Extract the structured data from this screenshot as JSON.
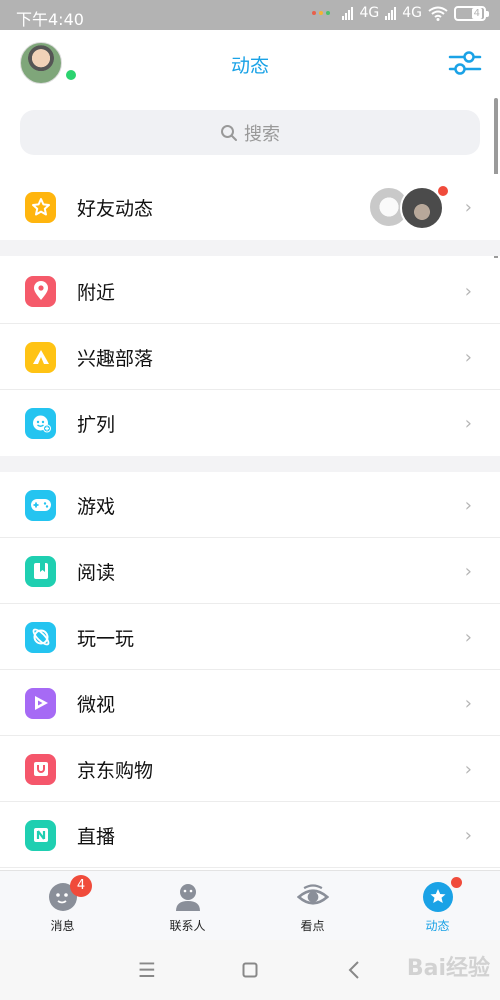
{
  "status_bar": {
    "time": "下午4:40",
    "network_1": "4G",
    "network_2": "4G",
    "battery": "4",
    "dot_colors": [
      "#e8604c",
      "#f5b335",
      "#4cc06a"
    ]
  },
  "header": {
    "title": "动态",
    "avatar_icon": "user-avatar",
    "online_color": "#2bd36f",
    "settings_icon": "filter-sliders-icon",
    "accent": "#1aa2e6"
  },
  "search": {
    "placeholder": "搜索",
    "icon": "search-icon"
  },
  "list": {
    "friends_feed": {
      "label": "好友动态",
      "icon": "star-icon",
      "color": "#ffb50e"
    },
    "group2": [
      {
        "label": "附近",
        "icon": "location-pin-icon",
        "color": "#f55a6a"
      },
      {
        "label": "兴趣部落",
        "icon": "tent-icon",
        "color": "#ffc314"
      },
      {
        "label": "扩列",
        "icon": "smile-add-icon",
        "color": "#24c4f0"
      }
    ],
    "group3": [
      {
        "label": "游戏",
        "icon": "gamepad-icon",
        "color": "#24c4f0"
      },
      {
        "label": "阅读",
        "icon": "book-icon",
        "color": "#1fcfb1"
      },
      {
        "label": "玩一玩",
        "icon": "planet-icon",
        "color": "#24c4f0"
      },
      {
        "label": "微视",
        "icon": "play-icon",
        "color": "#a66af5"
      },
      {
        "label": "京东购物",
        "icon": "shopping-bag-icon",
        "color": "#f5566b"
      },
      {
        "label": "直播",
        "icon": "live-icon",
        "color": "#1fcfb1"
      }
    ]
  },
  "tabbar": {
    "tabs": [
      {
        "label": "消息",
        "icon": "message-face-icon",
        "badge": "4"
      },
      {
        "label": "联系人",
        "icon": "contacts-icon"
      },
      {
        "label": "看点",
        "icon": "eye-icon"
      },
      {
        "label": "动态",
        "icon": "star-circle-icon",
        "active": true
      }
    ]
  },
  "navbar": {
    "menu_icon": "menu-icon",
    "home_icon": "home-square-icon",
    "back_icon": "back-icon",
    "watermark": "Bai经验"
  }
}
